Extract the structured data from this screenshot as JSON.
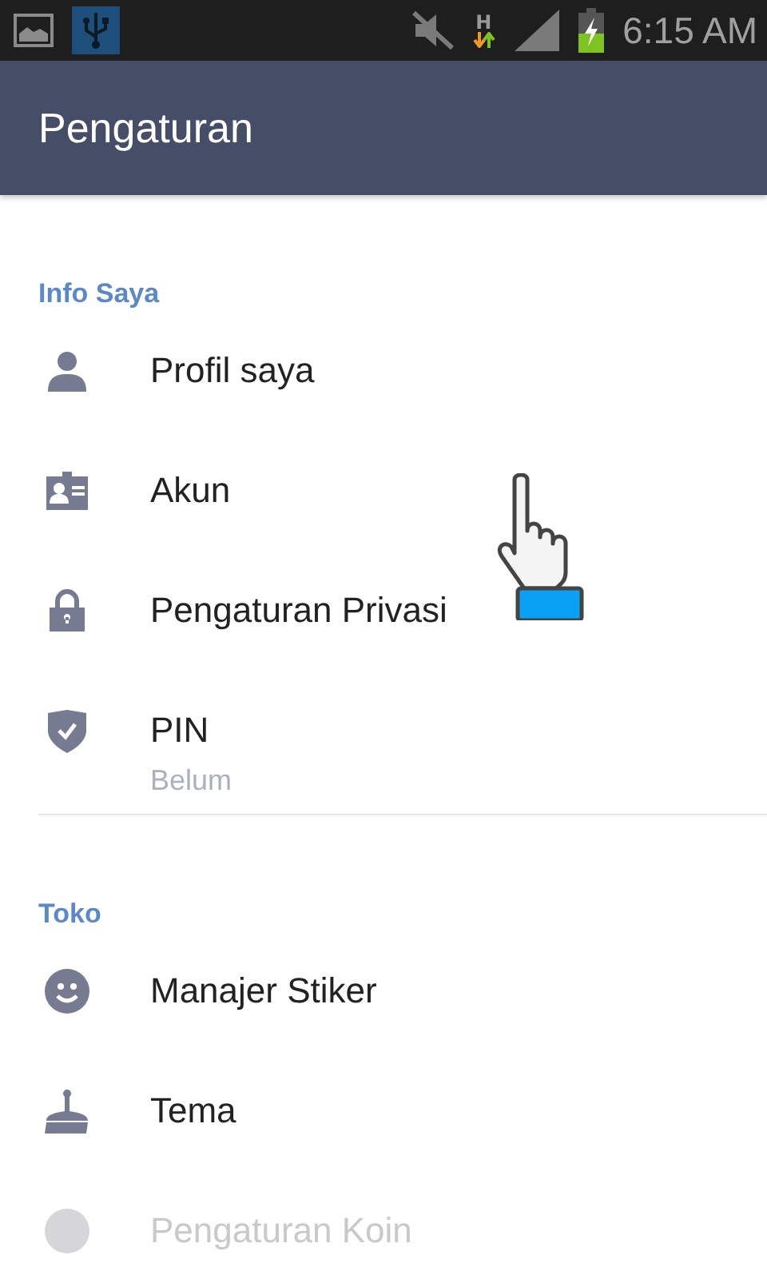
{
  "status_bar": {
    "time": "6:15 AM",
    "network": "H"
  },
  "header": {
    "title": "Pengaturan"
  },
  "sections": [
    {
      "title": "Info Saya",
      "items": [
        {
          "kind": "person",
          "label": "Profil saya"
        },
        {
          "kind": "card",
          "label": "Akun"
        },
        {
          "kind": "lock",
          "label": "Pengaturan Privasi"
        },
        {
          "kind": "shield",
          "label": "PIN",
          "subtitle": "Belum"
        }
      ]
    },
    {
      "title": "Toko",
      "items": [
        {
          "kind": "smile",
          "label": "Manajer Stiker"
        },
        {
          "kind": "brush",
          "label": "Tema"
        },
        {
          "kind": "coin",
          "label": "Pengaturan Koin",
          "disabled": true
        }
      ]
    }
  ]
}
